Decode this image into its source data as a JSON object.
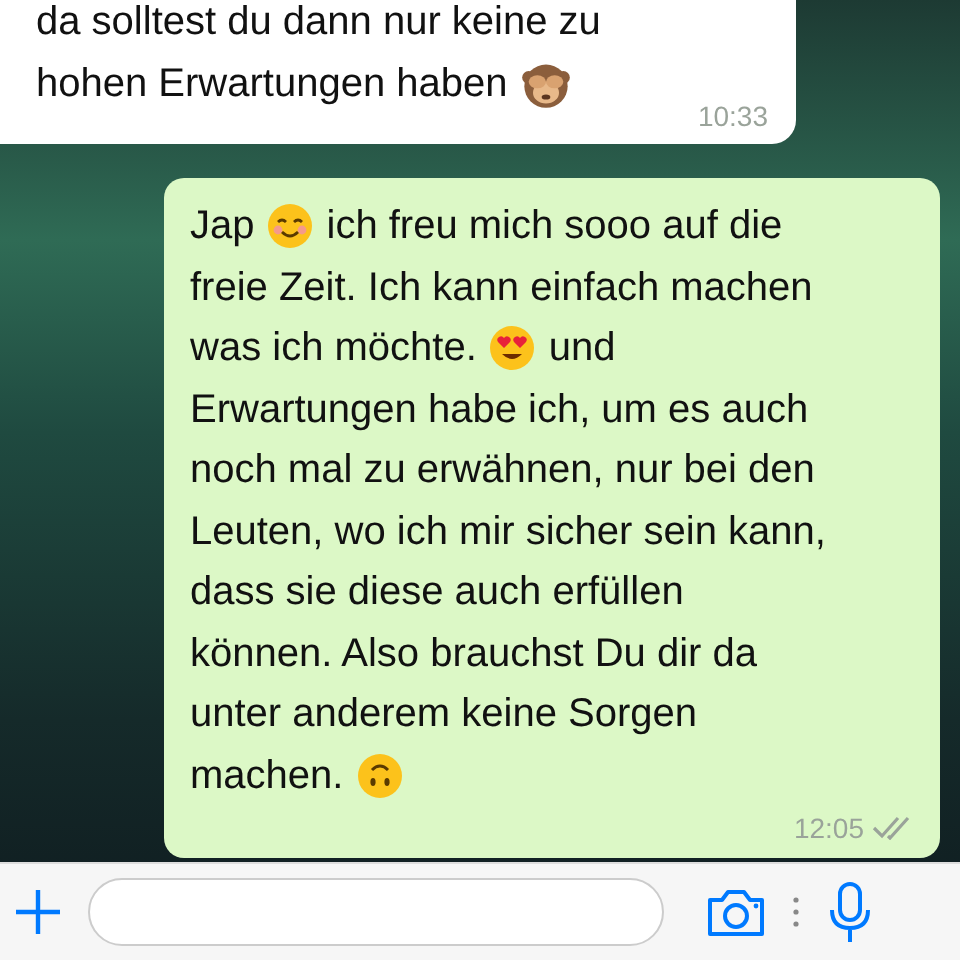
{
  "messages": [
    {
      "kind": "incoming",
      "lines": [
        [
          {
            "kind": "text",
            "text": "da solltest du dann nur keine zu"
          }
        ],
        [
          {
            "kind": "text",
            "text": "hohen Erwartungen haben"
          },
          {
            "kind": "monkey"
          }
        ]
      ],
      "time": "10:33"
    },
    {
      "kind": "outgoing",
      "lines": [
        [
          {
            "kind": "text",
            "text": "Jap"
          },
          {
            "kind": "smile"
          },
          {
            "kind": "text",
            "text": "ich freu mich sooo auf die"
          }
        ],
        [
          {
            "kind": "text",
            "text": "freie Zeit. Ich kann einfach machen"
          }
        ],
        [
          {
            "kind": "text",
            "text": "was ich möchte."
          },
          {
            "kind": "hearteyes"
          },
          {
            "kind": "text",
            "text": "und"
          }
        ],
        [
          {
            "kind": "text",
            "text": "Erwartungen habe ich, um es auch"
          }
        ],
        [
          {
            "kind": "text",
            "text": "noch mal zu erwähnen, nur bei den"
          }
        ],
        [
          {
            "kind": "text",
            "text": "Leuten, wo ich mir sicher sein kann,"
          }
        ],
        [
          {
            "kind": "text",
            "text": "dass sie diese auch erfüllen"
          }
        ],
        [
          {
            "kind": "text",
            "text": "können. Also brauchst Du dir da"
          }
        ],
        [
          {
            "kind": "text",
            "text": "unter anderem keine Sorgen"
          }
        ],
        [
          {
            "kind": "text",
            "text": "machen."
          },
          {
            "kind": "upside"
          }
        ]
      ],
      "time": "12:05",
      "read": false
    }
  ]
}
